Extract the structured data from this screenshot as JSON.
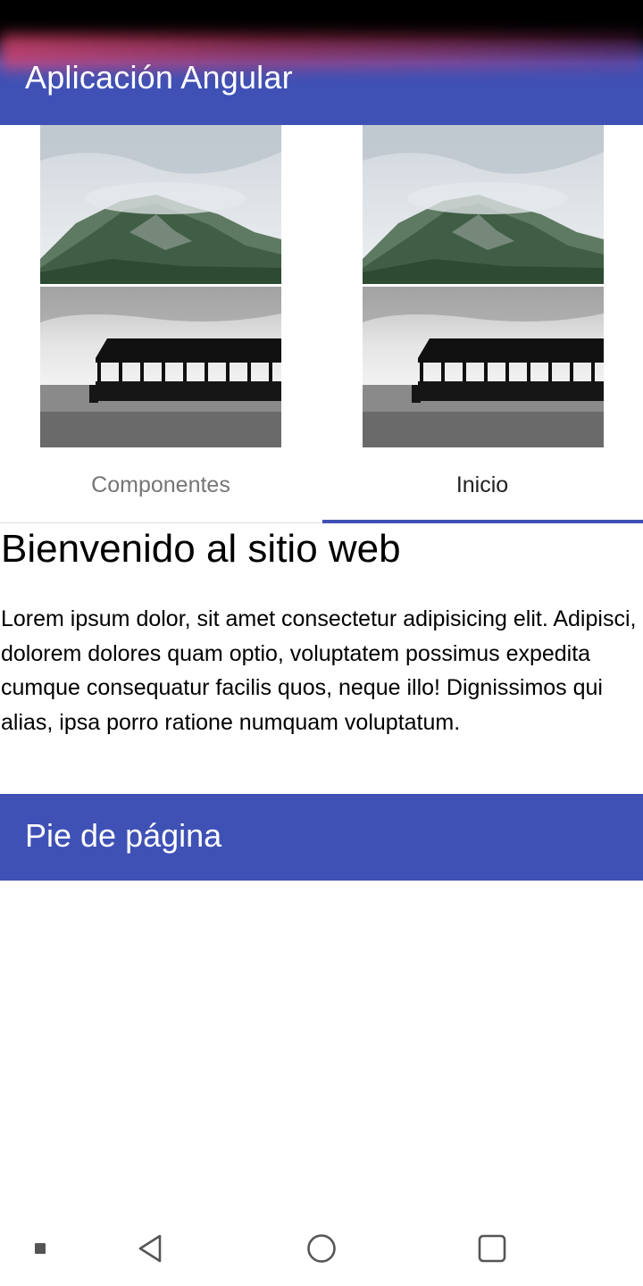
{
  "toolbar": {
    "title": "Aplicación Angular"
  },
  "gallery": {
    "images": [
      {
        "icon": "mountain-image"
      },
      {
        "icon": "mountain-image"
      },
      {
        "icon": "pier-image"
      },
      {
        "icon": "pier-image"
      }
    ]
  },
  "tabs": [
    {
      "label": "Componentes",
      "selected": false
    },
    {
      "label": "Inicio",
      "selected": true
    }
  ],
  "content": {
    "heading": "Bienvenido al sitio web",
    "paragraph": "Lorem ipsum dolor, sit amet consectetur adipisicing elit. Adipisci, dolorem dolores quam optio, voluptatem possimus expedita cumque consequatur facilis quos, neque illo! Dignissimos qui alias, ipsa porro ratione numquam voluptatum."
  },
  "footer": {
    "title": "Pie de página"
  },
  "colors": {
    "primary": "#3f51b5",
    "tab_inactive": "#757575",
    "tab_active": "#212121"
  },
  "navbar": {
    "icons": [
      "menu-dot-icon",
      "back-icon",
      "home-icon",
      "recents-icon"
    ]
  }
}
